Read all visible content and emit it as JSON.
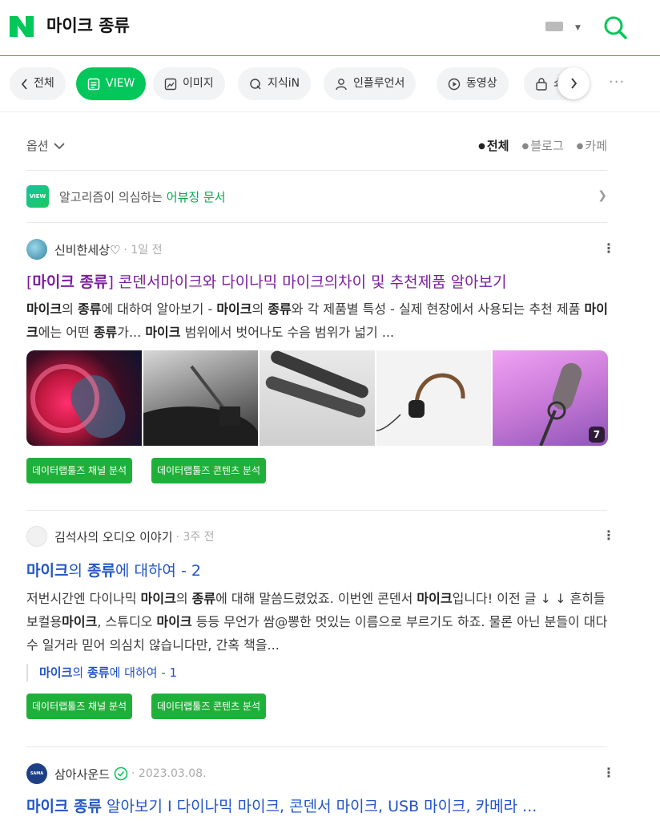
{
  "header": {
    "logo": "N",
    "query": "마이크 종류"
  },
  "tabs": [
    {
      "label": "전체",
      "icon": "chevron-left-icon"
    },
    {
      "label": "VIEW",
      "icon": "view-icon"
    },
    {
      "label": "이미지",
      "icon": "image-icon"
    },
    {
      "label": "지식iN",
      "icon": "q-icon"
    },
    {
      "label": "인플루언서",
      "icon": "person-icon"
    },
    {
      "label": "동영상",
      "icon": "play-icon"
    },
    {
      "label": "쇼",
      "icon": "shopping-bag-icon"
    }
  ],
  "options": {
    "label": "옵션",
    "filters": [
      "전체",
      "블로그",
      "카페"
    ],
    "active_filter": "전체"
  },
  "notice": {
    "badge": "VIEW",
    "text": "알고리즘이 의심하는",
    "highlight": "어뷰징 문서"
  },
  "posts": [
    {
      "author": "신비한세상♡",
      "time": "· 1일 전",
      "title_prefix": "[",
      "title_bold": "마이크 종류",
      "title_rest": "] 콘덴서마이크와 다이나믹 마이크의차이 및 추천제품 알아보기",
      "body": [
        {
          "b": "마이크"
        },
        {
          "t": "의 "
        },
        {
          "b": "종류"
        },
        {
          "t": "에 대하여 알아보기 - "
        },
        {
          "b": "마이크"
        },
        {
          "t": "의 "
        },
        {
          "b": "종류"
        },
        {
          "t": "와 각 제품별 특성 - 실제 현장에서 사용되는 추천 제품 "
        },
        {
          "b": "마이크"
        },
        {
          "t": "에는 어떤 "
        },
        {
          "b": "종류"
        },
        {
          "t": "가... "
        },
        {
          "b": "마이크"
        },
        {
          "t": " 범위에서 벗어나도 수음 범위가 넓기 ..."
        }
      ],
      "image_count": "7",
      "tags": [
        "데이터랩툴즈 채널 분석",
        "데이터랩툴즈 콘텐츠 분석"
      ]
    },
    {
      "author": "김석사의 오디오 이야기",
      "time": "· 3주 전",
      "title_parts": [
        {
          "b": "마이크"
        },
        {
          "t": "의 "
        },
        {
          "b": "종류"
        },
        {
          "t": "에 대하여 - 2"
        }
      ],
      "body": [
        {
          "t": "저번시간엔 다이나믹 "
        },
        {
          "b": "마이크"
        },
        {
          "t": "의 "
        },
        {
          "b": "종류"
        },
        {
          "t": "에 대해 말씀드렸었죠. 이번엔 콘덴서 "
        },
        {
          "b": "마이크"
        },
        {
          "t": "입니다! 이전 글 ↓ ↓ 흔히들 보컬용"
        },
        {
          "b": "마이크"
        },
        {
          "t": ", 스튜디오 "
        },
        {
          "b": "마이크"
        },
        {
          "t": " 등등 무언가 쌈@뽕한 멋있는 이름으로 부르기도 하죠. 물론 아닌 분들이 대다수 일거라 믿어 의심치 않습니다만, 간혹 책을..."
        }
      ],
      "sub_link": [
        {
          "b": "마이크"
        },
        {
          "t": "의 "
        },
        {
          "b": "종류"
        },
        {
          "t": "에 대하여 - 1"
        }
      ],
      "tags": [
        "데이터랩툴즈 채널 분석",
        "데이터랩툴즈 콘텐츠 분석"
      ]
    },
    {
      "author": "삼아사운드",
      "avatar_text": "SAMA",
      "time": "· 2023.03.08.",
      "title_parts": [
        {
          "b": "마이크 종류"
        },
        {
          "t": " 알아보기 I 다이나믹 마이크, 콘덴서 마이크, USB 마이크, 카메라 ..."
        }
      ]
    }
  ],
  "colors": {
    "brand": "#03c75a",
    "visited_title": "#7b1e9e",
    "link_title": "#2355c6",
    "tag": "#1fb03a"
  }
}
